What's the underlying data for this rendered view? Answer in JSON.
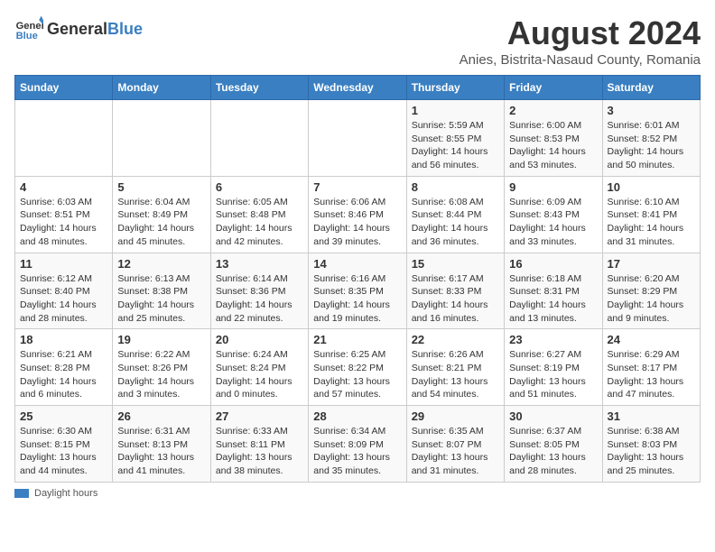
{
  "header": {
    "logo_general": "General",
    "logo_blue": "Blue",
    "month_year": "August 2024",
    "subtitle": "Anies, Bistrita-Nasaud County, Romania"
  },
  "weekdays": [
    "Sunday",
    "Monday",
    "Tuesday",
    "Wednesday",
    "Thursday",
    "Friday",
    "Saturday"
  ],
  "weeks": [
    [
      {
        "day": "",
        "detail": ""
      },
      {
        "day": "",
        "detail": ""
      },
      {
        "day": "",
        "detail": ""
      },
      {
        "day": "",
        "detail": ""
      },
      {
        "day": "1",
        "detail": "Sunrise: 5:59 AM\nSunset: 8:55 PM\nDaylight: 14 hours\nand 56 minutes."
      },
      {
        "day": "2",
        "detail": "Sunrise: 6:00 AM\nSunset: 8:53 PM\nDaylight: 14 hours\nand 53 minutes."
      },
      {
        "day": "3",
        "detail": "Sunrise: 6:01 AM\nSunset: 8:52 PM\nDaylight: 14 hours\nand 50 minutes."
      }
    ],
    [
      {
        "day": "4",
        "detail": "Sunrise: 6:03 AM\nSunset: 8:51 PM\nDaylight: 14 hours\nand 48 minutes."
      },
      {
        "day": "5",
        "detail": "Sunrise: 6:04 AM\nSunset: 8:49 PM\nDaylight: 14 hours\nand 45 minutes."
      },
      {
        "day": "6",
        "detail": "Sunrise: 6:05 AM\nSunset: 8:48 PM\nDaylight: 14 hours\nand 42 minutes."
      },
      {
        "day": "7",
        "detail": "Sunrise: 6:06 AM\nSunset: 8:46 PM\nDaylight: 14 hours\nand 39 minutes."
      },
      {
        "day": "8",
        "detail": "Sunrise: 6:08 AM\nSunset: 8:44 PM\nDaylight: 14 hours\nand 36 minutes."
      },
      {
        "day": "9",
        "detail": "Sunrise: 6:09 AM\nSunset: 8:43 PM\nDaylight: 14 hours\nand 33 minutes."
      },
      {
        "day": "10",
        "detail": "Sunrise: 6:10 AM\nSunset: 8:41 PM\nDaylight: 14 hours\nand 31 minutes."
      }
    ],
    [
      {
        "day": "11",
        "detail": "Sunrise: 6:12 AM\nSunset: 8:40 PM\nDaylight: 14 hours\nand 28 minutes."
      },
      {
        "day": "12",
        "detail": "Sunrise: 6:13 AM\nSunset: 8:38 PM\nDaylight: 14 hours\nand 25 minutes."
      },
      {
        "day": "13",
        "detail": "Sunrise: 6:14 AM\nSunset: 8:36 PM\nDaylight: 14 hours\nand 22 minutes."
      },
      {
        "day": "14",
        "detail": "Sunrise: 6:16 AM\nSunset: 8:35 PM\nDaylight: 14 hours\nand 19 minutes."
      },
      {
        "day": "15",
        "detail": "Sunrise: 6:17 AM\nSunset: 8:33 PM\nDaylight: 14 hours\nand 16 minutes."
      },
      {
        "day": "16",
        "detail": "Sunrise: 6:18 AM\nSunset: 8:31 PM\nDaylight: 14 hours\nand 13 minutes."
      },
      {
        "day": "17",
        "detail": "Sunrise: 6:20 AM\nSunset: 8:29 PM\nDaylight: 14 hours\nand 9 minutes."
      }
    ],
    [
      {
        "day": "18",
        "detail": "Sunrise: 6:21 AM\nSunset: 8:28 PM\nDaylight: 14 hours\nand 6 minutes."
      },
      {
        "day": "19",
        "detail": "Sunrise: 6:22 AM\nSunset: 8:26 PM\nDaylight: 14 hours\nand 3 minutes."
      },
      {
        "day": "20",
        "detail": "Sunrise: 6:24 AM\nSunset: 8:24 PM\nDaylight: 14 hours\nand 0 minutes."
      },
      {
        "day": "21",
        "detail": "Sunrise: 6:25 AM\nSunset: 8:22 PM\nDaylight: 13 hours\nand 57 minutes."
      },
      {
        "day": "22",
        "detail": "Sunrise: 6:26 AM\nSunset: 8:21 PM\nDaylight: 13 hours\nand 54 minutes."
      },
      {
        "day": "23",
        "detail": "Sunrise: 6:27 AM\nSunset: 8:19 PM\nDaylight: 13 hours\nand 51 minutes."
      },
      {
        "day": "24",
        "detail": "Sunrise: 6:29 AM\nSunset: 8:17 PM\nDaylight: 13 hours\nand 47 minutes."
      }
    ],
    [
      {
        "day": "25",
        "detail": "Sunrise: 6:30 AM\nSunset: 8:15 PM\nDaylight: 13 hours\nand 44 minutes."
      },
      {
        "day": "26",
        "detail": "Sunrise: 6:31 AM\nSunset: 8:13 PM\nDaylight: 13 hours\nand 41 minutes."
      },
      {
        "day": "27",
        "detail": "Sunrise: 6:33 AM\nSunset: 8:11 PM\nDaylight: 13 hours\nand 38 minutes."
      },
      {
        "day": "28",
        "detail": "Sunrise: 6:34 AM\nSunset: 8:09 PM\nDaylight: 13 hours\nand 35 minutes."
      },
      {
        "day": "29",
        "detail": "Sunrise: 6:35 AM\nSunset: 8:07 PM\nDaylight: 13 hours\nand 31 minutes."
      },
      {
        "day": "30",
        "detail": "Sunrise: 6:37 AM\nSunset: 8:05 PM\nDaylight: 13 hours\nand 28 minutes."
      },
      {
        "day": "31",
        "detail": "Sunrise: 6:38 AM\nSunset: 8:03 PM\nDaylight: 13 hours\nand 25 minutes."
      }
    ]
  ],
  "footer": {
    "legend_label": "Daylight hours"
  }
}
